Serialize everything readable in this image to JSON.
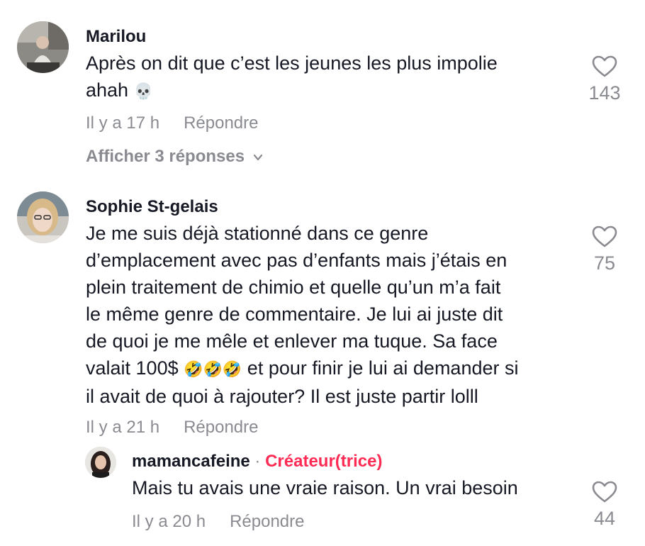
{
  "comments": [
    {
      "username": "Marilou",
      "text_lines": [
        "Après on dit que c’est les jeunes les plus impolie",
        "ahah"
      ],
      "emoji": "💀",
      "time": "Il y a 17 h",
      "reply_label": "Répondre",
      "view_replies": "Afficher 3 réponses",
      "likes": "143",
      "icon": "heart-outline-icon"
    },
    {
      "username": "Sophie St-gelais",
      "text_lines": [
        "Je me suis déjà stationné dans ce genre",
        "d’emplacement avec pas d’enfants mais j’étais en",
        "plein traitement de chimio et quelle qu’un m’a fait",
        "le même genre de commentaire. Je lui ai juste dit",
        "de quoi je me mêle et enlever ma tuque. Sa face"
      ],
      "line6_before": "valait 100$ ",
      "emojis": "🤣🤣🤣",
      "line6_after": " et pour finir je lui ai demander si",
      "line7": "il avait de quoi à rajouter? Il est juste partir lolll",
      "time": "Il y a 21 h",
      "reply_label": "Répondre",
      "likes": "75"
    }
  ],
  "reply": {
    "username": "mamancafeine",
    "separator": " · ",
    "badge": "Créateur(trice)",
    "text": "Mais tu avais une vraie raison. Un vrai besoin",
    "time": "Il y a 20 h",
    "reply_label": "Répondre",
    "likes": "44"
  },
  "colors": {
    "text": "#161823",
    "muted": "#8a8b91",
    "creator": "#fe2c55"
  }
}
